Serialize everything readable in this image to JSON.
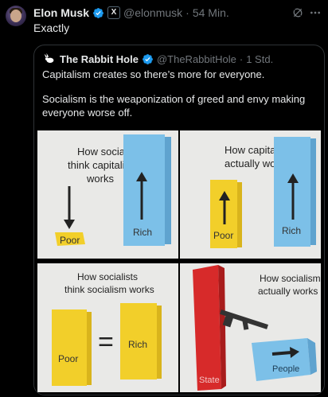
{
  "tweet": {
    "author_name": "Elon Musk",
    "handle": "@elonmusk",
    "separator": "·",
    "time": "54 Min.",
    "text": "Exactly",
    "x_badge": "X"
  },
  "quoted": {
    "author_name": "The Rabbit Hole",
    "handle": "@TheRabbitHole",
    "separator": "·",
    "time": "1 Std.",
    "paragraphs": [
      "Capitalism creates so there’s more for everyone.",
      "Socialism is the weaponization of greed and envy making everyone worse off."
    ]
  },
  "image_panels": [
    {
      "caption": [
        "How socialists",
        "think capitalism",
        "works"
      ],
      "labels": {
        "small": "Poor",
        "tall": "Rich"
      }
    },
    {
      "caption": [
        "How capitalism",
        "actually works"
      ],
      "labels": {
        "small": "Poor",
        "tall": "Rich"
      }
    },
    {
      "caption": [
        "How socialists",
        "think socialism works"
      ],
      "labels": {
        "left": "Poor",
        "right": "Rich",
        "sign": "="
      }
    },
    {
      "caption": [
        "How socialism",
        "actually works"
      ],
      "labels": {
        "tall": "State",
        "box": "People"
      }
    }
  ],
  "icons": {
    "verified": "verified-badge-icon",
    "grok": "grok-icon",
    "more": "more-icon"
  },
  "colors": {
    "verified_blue": "#1d9bf0",
    "muted": "#71767b",
    "border": "#2f3336",
    "block_yellow": "#f2cf2a",
    "block_blue": "#7cc0e8",
    "block_red": "#d72a2a"
  }
}
